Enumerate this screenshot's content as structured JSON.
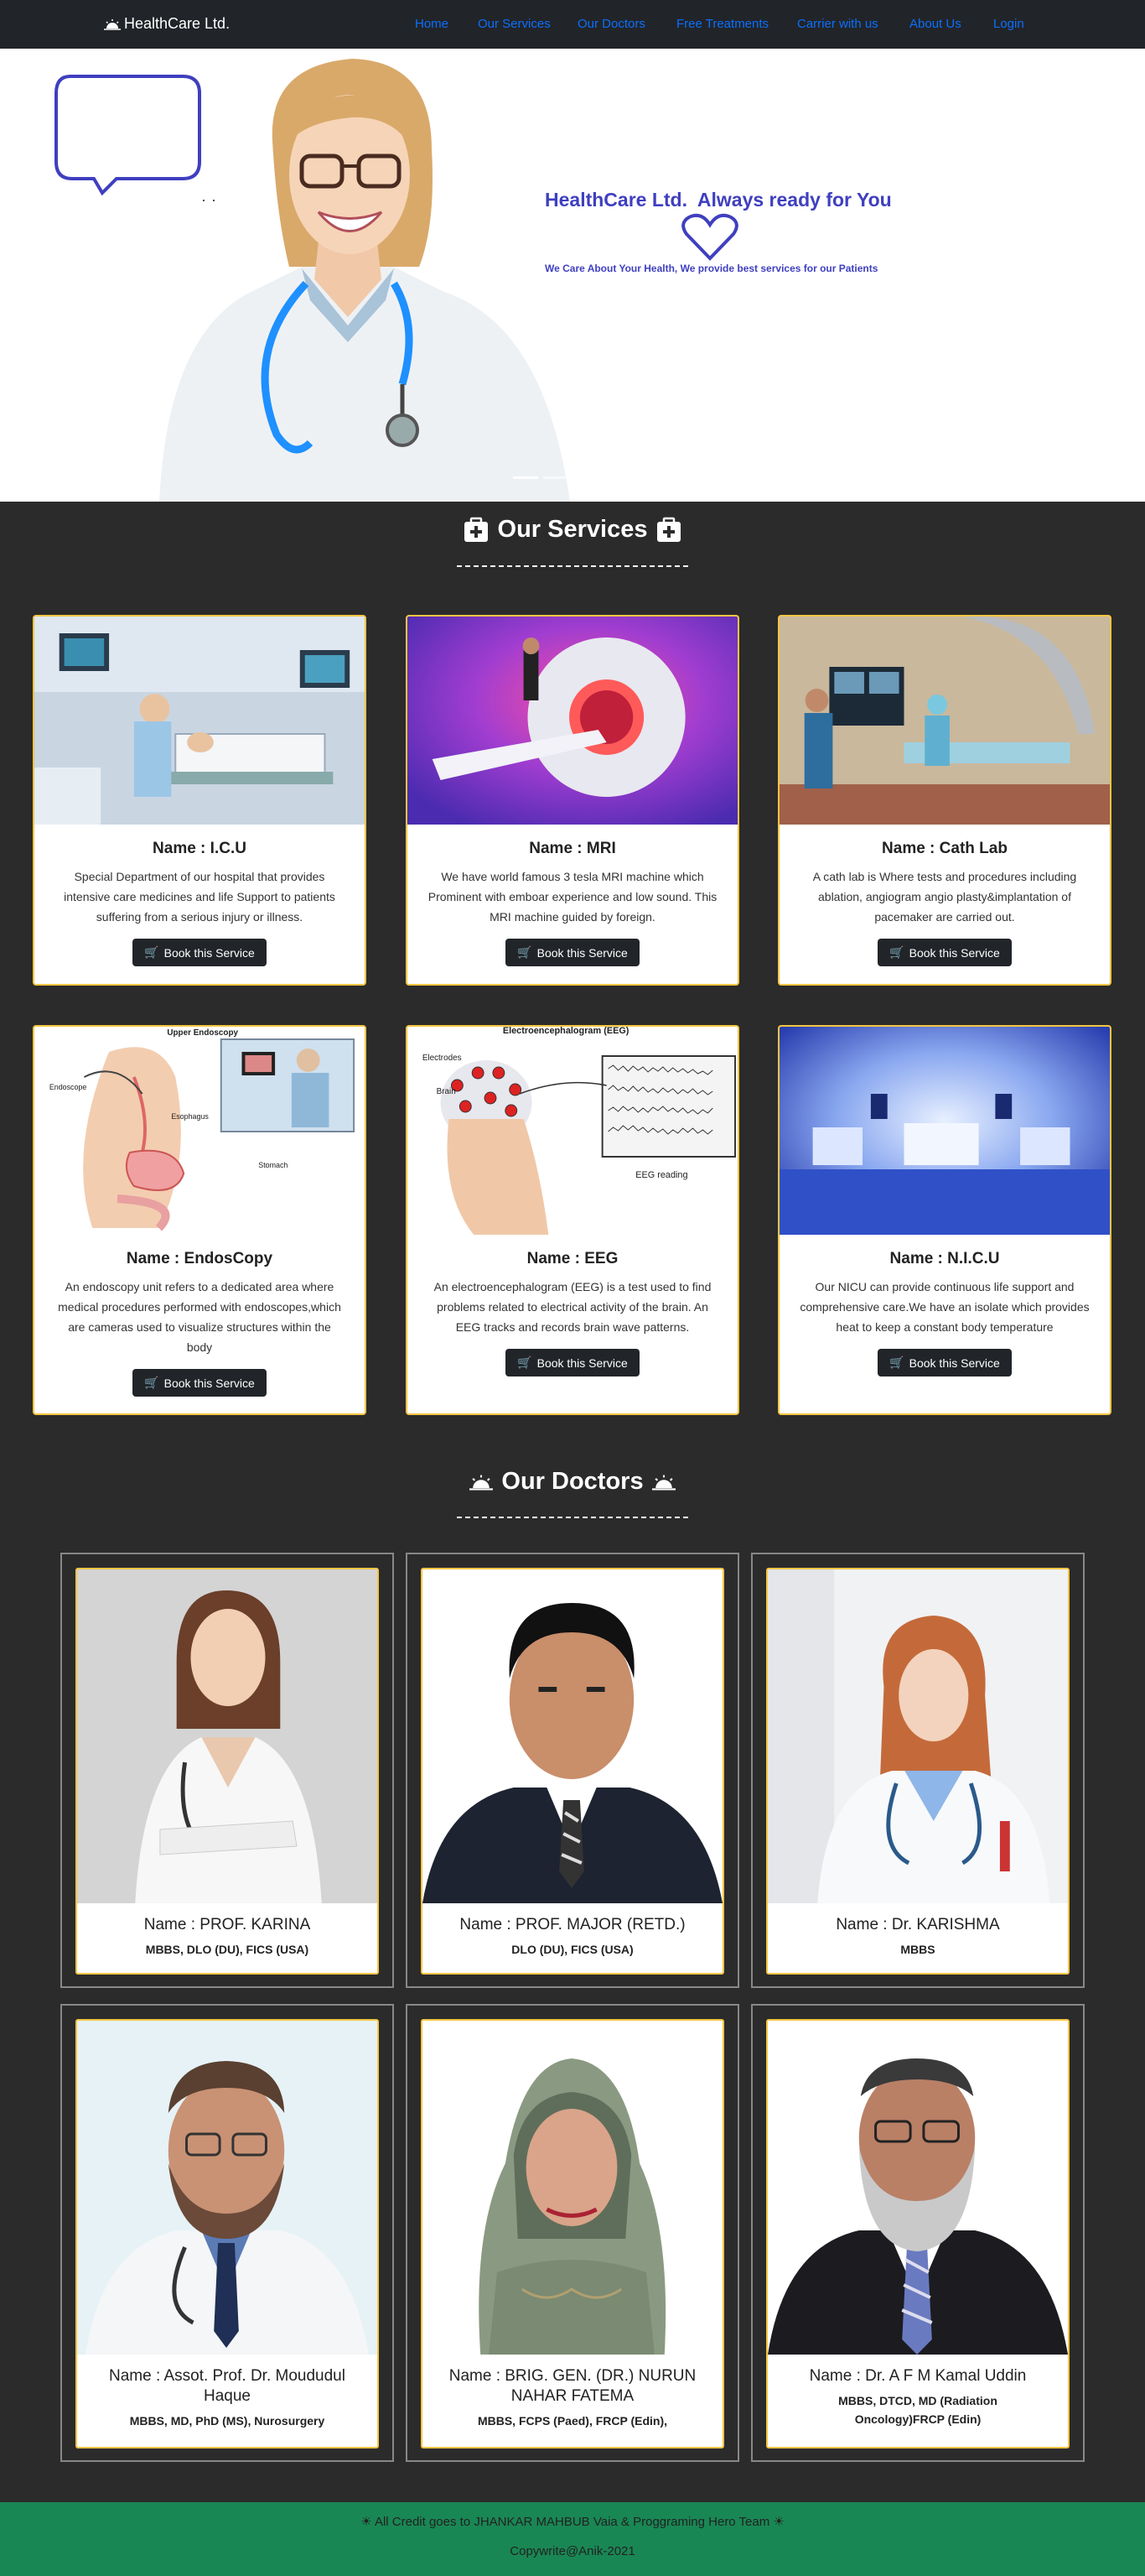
{
  "nav": {
    "brand": "HealthCare Ltd.",
    "links": [
      "Home",
      "Our Services",
      "Our Doctors",
      "Free Treatments",
      "Carrier with us",
      "About Us",
      "Login"
    ]
  },
  "hero": {
    "title": "HealthCare Ltd.  Always ready for You",
    "subtitle": "We Care About Your Health, We provide best services for our Patients",
    "accent": "#3f3fc0"
  },
  "services": {
    "title": "Our Services",
    "book_label": "Book this Service",
    "items": [
      {
        "name": "Name : I.C.U",
        "desc": "Special Department of our hospital that provides intensive care medicines and life Support to patients suffering from a serious injury or illness."
      },
      {
        "name": "Name : MRI",
        "desc": "We have world famous 3 tesla MRI machine which Prominent with emboar experience and low sound. This MRI machine guided by foreign."
      },
      {
        "name": "Name : Cath Lab",
        "desc": "A cath lab is Where tests and procedures including ablation, angiogram angio plasty&implantation of pacemaker are carried out."
      },
      {
        "name": "Name : EndosCopy",
        "desc": "An endoscopy unit refers to a dedicated area where medical procedures performed with endoscopes,which are cameras used to visualize structures within the body"
      },
      {
        "name": "Name : EEG",
        "desc": "An electroencephalogram (EEG) is a test used to find problems related to electrical activity of the brain. An EEG tracks and records brain wave patterns."
      },
      {
        "name": "Name : N.I.C.U",
        "desc": "Our NICU can provide continuous life support and comprehensive care.We have an isolate which provides heat to keep a constant body temperature"
      }
    ],
    "image_labels": {
      "endoscopy": [
        "Upper Endoscopy",
        "Endoscope",
        "Esophagus",
        "Stomach"
      ],
      "eeg": [
        "Electroencephalogram (EEG)",
        "Electrodes",
        "Brain",
        "EEG reading"
      ]
    }
  },
  "doctors": {
    "title": "Our Doctors",
    "items": [
      {
        "name": "Name : PROF. KARINA",
        "degree": "MBBS, DLO (DU), FICS (USA)"
      },
      {
        "name": "Name : PROF. MAJOR (RETD.)",
        "degree": "DLO (DU), FICS (USA)"
      },
      {
        "name": "Name : Dr. KARISHMA",
        "degree": "MBBS"
      },
      {
        "name": "Name : Assot. Prof. Dr. Moududul Haque",
        "degree": "MBBS, MD, PhD (MS), Nurosurgery"
      },
      {
        "name": "Name : BRIG. GEN. (DR.) NURUN NAHAR FATEMA",
        "degree": "MBBS, FCPS (Paed), FRCP (Edin),"
      },
      {
        "name": "Name : Dr. A F M Kamal Uddin",
        "degree": "MBBS, DTCD, MD (Radiation Oncology)FRCP (Edin)"
      }
    ]
  },
  "footer": {
    "credit": "All Credit goes to JHANKAR MAHBUB Vaia & Proggraming Hero Team",
    "copyright": "Copywrite@Anik-2021",
    "color": "#198754"
  }
}
